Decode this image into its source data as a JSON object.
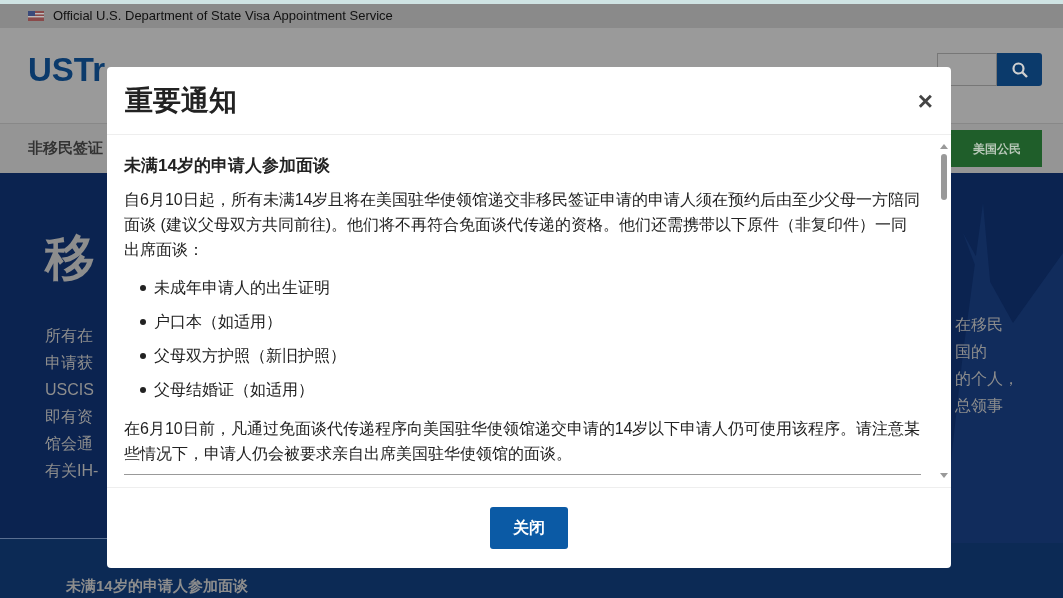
{
  "top_bar": {
    "text": "Official U.S. Department of State Visa Appointment Service"
  },
  "header": {
    "logo": "USTr"
  },
  "nav": {
    "item": "非移民签证",
    "button": "美国公民"
  },
  "hero": {
    "heading": "移",
    "left_lines": [
      "所有在",
      "申请获",
      "USCIS",
      "即有资",
      "馆会通",
      "有关IH-"
    ],
    "right_lines": [
      "在移民",
      "国的",
      "的个人，",
      "总领事"
    ]
  },
  "footer_band": {
    "text": "未满14岁的申请人参加面谈"
  },
  "modal": {
    "title": "重要通知",
    "close_icon": "×",
    "section_title": "未满14岁的申请人参加面谈",
    "paragraph_1": "自6月10日起，所有未满14岁且将在美国驻华使领馆递交非移民签证申请的申请人须在预约后由至少父母一方陪同面谈 (建议父母双方共同前往)。他们将不再符合免面谈代传递的资格。他们还需携带以下原件（非复印件）一同出席面谈：",
    "bullets": [
      "未成年申请人的出生证明",
      "户口本（如适用）",
      "父母双方护照（新旧护照）",
      "父母结婚证（如适用）"
    ],
    "paragraph_2": "在6月10日前，凡通过免面谈代传递程序向美国驻华使领馆递交申请的14岁以下申请人仍可使用该程序。请注意某些情况下，申请人仍会被要求亲自出席美国驻华使领馆的面谈。",
    "button": "关闭"
  }
}
